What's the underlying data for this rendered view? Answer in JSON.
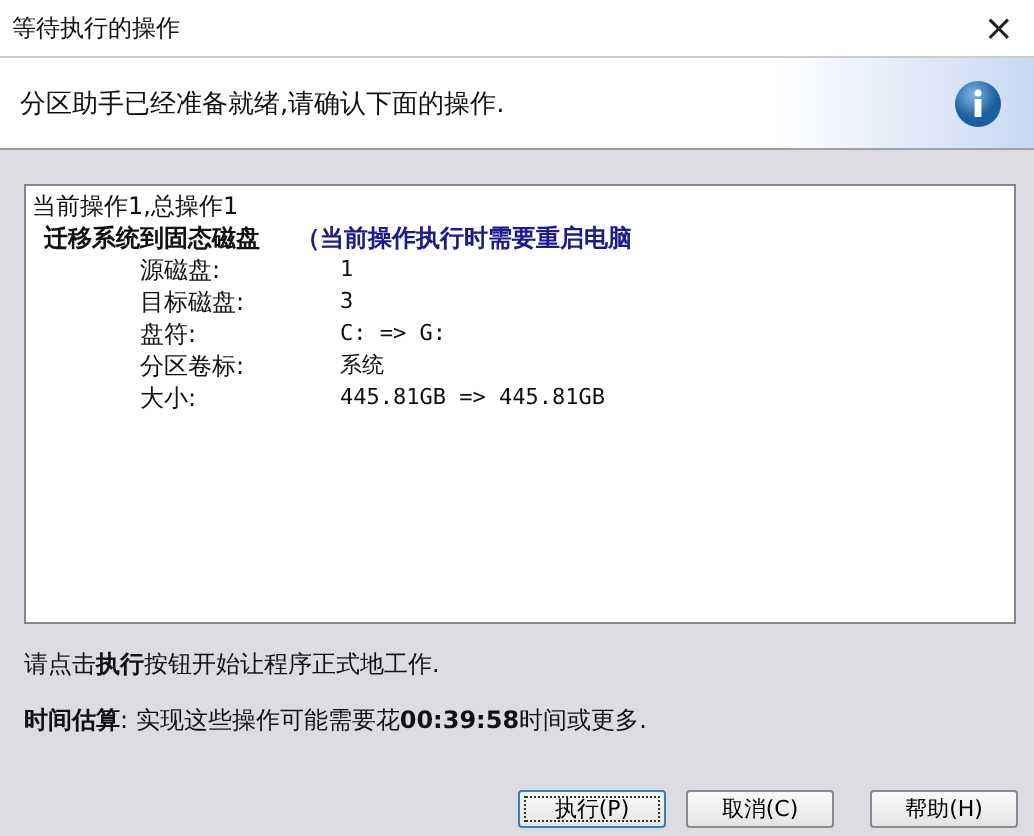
{
  "window": {
    "title": "等待执行的操作",
    "close": "×"
  },
  "header": {
    "message": "分区助手已经准备就绪,请确认下面的操作."
  },
  "operations": {
    "summary": "当前操作1,总操作1",
    "title": "迁移系统到固态磁盘",
    "note": "（当前操作执行时需要重启电脑",
    "details": [
      {
        "label": "源磁盘:",
        "value": "1"
      },
      {
        "label": "目标磁盘:",
        "value": "3"
      },
      {
        "label": "盘符:",
        "value": "C: => G:"
      },
      {
        "label": "分区卷标:",
        "value": "系统"
      },
      {
        "label": "大小:",
        "value": "445.81GB => 445.81GB"
      }
    ]
  },
  "instruction": "请点击**执行**按钮开始让程序正式地工作.",
  "estimate": "**时间估算**: 实现这些操作可能需要花**00:39:58**时间或更多.",
  "buttons": [
    {
      "label": "执行(P)",
      "focused": true
    },
    {
      "label": "取消(C)",
      "focused": false
    },
    {
      "label": "帮助(H)",
      "focused": false
    }
  ]
}
